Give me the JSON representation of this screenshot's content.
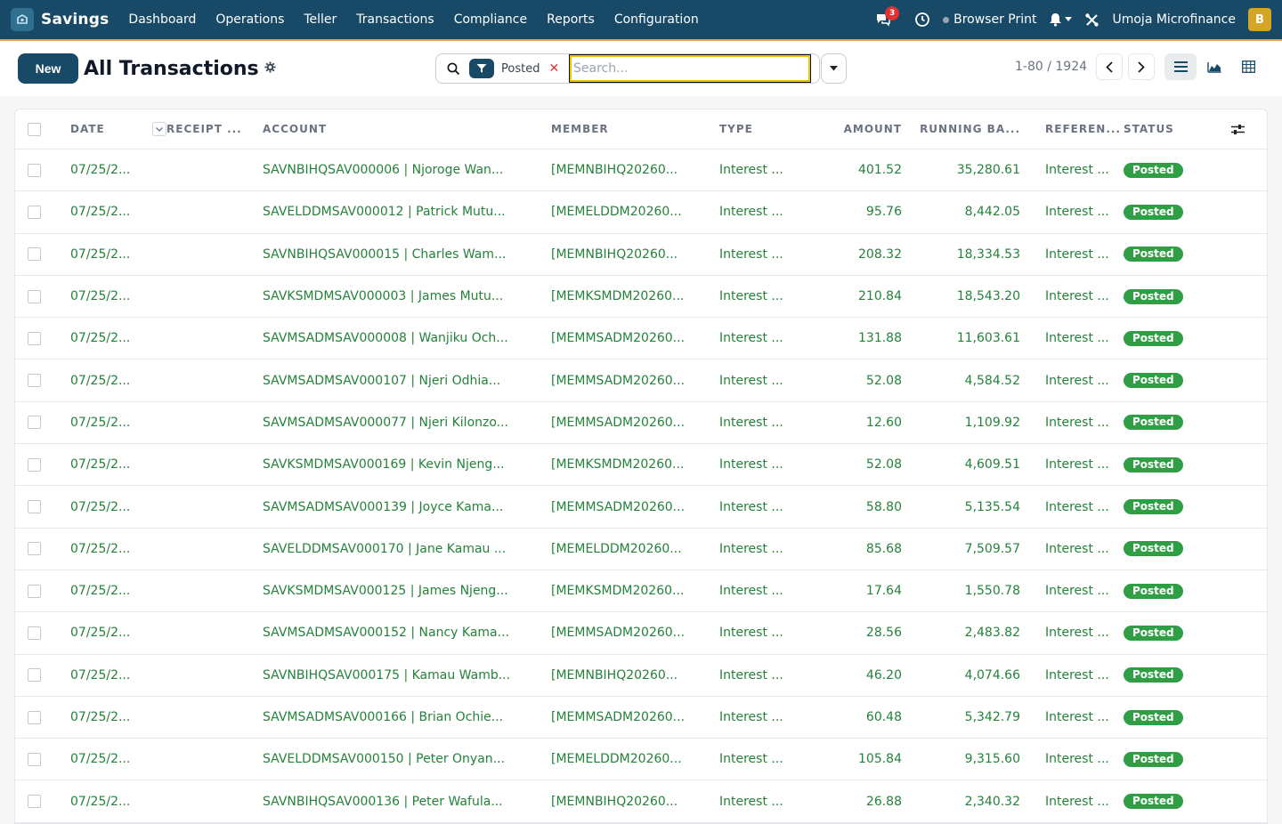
{
  "navbar": {
    "app_name": "Savings",
    "menu": [
      "Dashboard",
      "Operations",
      "Teller",
      "Transactions",
      "Compliance",
      "Reports",
      "Configuration"
    ],
    "notification_count": "3",
    "browser_print": "Browser Print",
    "company": "Umoja Microfinance",
    "avatar_letter": "B"
  },
  "controls": {
    "new_label": "New",
    "title": "All Transactions",
    "filter_label": "Posted",
    "filter_remove": "✕",
    "search_placeholder": "Search...",
    "pager_text": "1-80 / 1924"
  },
  "table": {
    "headers": {
      "date": "DATE",
      "receipt": "RECEIPT ...",
      "account": "ACCOUNT",
      "member": "MEMBER",
      "type": "TYPE",
      "amount": "AMOUNT",
      "running": "RUNNING BA...",
      "reference": "REFEREN...",
      "status": "STATUS"
    },
    "rows": [
      {
        "date": "07/25/2...",
        "account": "SAVNBIHQSAV000006 | Njoroge Wan...",
        "member": "[MEMNBIHQ20260...",
        "type": "Interest ...",
        "amount": "401.52",
        "running": "35,280.61",
        "reference": "Interest ...",
        "status": "Posted"
      },
      {
        "date": "07/25/2...",
        "account": "SAVELDDMSAV000012 | Patrick Mutu...",
        "member": "[MEMELDDM20260...",
        "type": "Interest ...",
        "amount": "95.76",
        "running": "8,442.05",
        "reference": "Interest ...",
        "status": "Posted"
      },
      {
        "date": "07/25/2...",
        "account": "SAVNBIHQSAV000015 | Charles Wam...",
        "member": "[MEMNBIHQ20260...",
        "type": "Interest ...",
        "amount": "208.32",
        "running": "18,334.53",
        "reference": "Interest ...",
        "status": "Posted"
      },
      {
        "date": "07/25/2...",
        "account": "SAVKSMDMSAV000003 | James Mutu...",
        "member": "[MEMKSMDM20260...",
        "type": "Interest ...",
        "amount": "210.84",
        "running": "18,543.20",
        "reference": "Interest ...",
        "status": "Posted"
      },
      {
        "date": "07/25/2...",
        "account": "SAVMSADMSAV000008 | Wanjiku Och...",
        "member": "[MEMMSADM20260...",
        "type": "Interest ...",
        "amount": "131.88",
        "running": "11,603.61",
        "reference": "Interest ...",
        "status": "Posted"
      },
      {
        "date": "07/25/2...",
        "account": "SAVMSADMSAV000107 | Njeri Odhia...",
        "member": "[MEMMSADM20260...",
        "type": "Interest ...",
        "amount": "52.08",
        "running": "4,584.52",
        "reference": "Interest ...",
        "status": "Posted"
      },
      {
        "date": "07/25/2...",
        "account": "SAVMSADMSAV000077 | Njeri Kilonzo...",
        "member": "[MEMMSADM20260...",
        "type": "Interest ...",
        "amount": "12.60",
        "running": "1,109.92",
        "reference": "Interest ...",
        "status": "Posted"
      },
      {
        "date": "07/25/2...",
        "account": "SAVKSMDMSAV000169 | Kevin Njeng...",
        "member": "[MEMKSMDM20260...",
        "type": "Interest ...",
        "amount": "52.08",
        "running": "4,609.51",
        "reference": "Interest ...",
        "status": "Posted"
      },
      {
        "date": "07/25/2...",
        "account": "SAVMSADMSAV000139 | Joyce Kama...",
        "member": "[MEMMSADM20260...",
        "type": "Interest ...",
        "amount": "58.80",
        "running": "5,135.54",
        "reference": "Interest ...",
        "status": "Posted"
      },
      {
        "date": "07/25/2...",
        "account": "SAVELDDMSAV000170 | Jane Kamau ...",
        "member": "[MEMELDDM20260...",
        "type": "Interest ...",
        "amount": "85.68",
        "running": "7,509.57",
        "reference": "Interest ...",
        "status": "Posted"
      },
      {
        "date": "07/25/2...",
        "account": "SAVKSMDMSAV000125 | James Njeng...",
        "member": "[MEMKSMDM20260...",
        "type": "Interest ...",
        "amount": "17.64",
        "running": "1,550.78",
        "reference": "Interest ...",
        "status": "Posted"
      },
      {
        "date": "07/25/2...",
        "account": "SAVMSADMSAV000152 | Nancy Kama...",
        "member": "[MEMMSADM20260...",
        "type": "Interest ...",
        "amount": "28.56",
        "running": "2,483.82",
        "reference": "Interest ...",
        "status": "Posted"
      },
      {
        "date": "07/25/2...",
        "account": "SAVNBIHQSAV000175 | Kamau Wamb...",
        "member": "[MEMNBIHQ20260...",
        "type": "Interest ...",
        "amount": "46.20",
        "running": "4,074.66",
        "reference": "Interest ...",
        "status": "Posted"
      },
      {
        "date": "07/25/2...",
        "account": "SAVMSADMSAV000166 | Brian Ochie...",
        "member": "[MEMMSADM20260...",
        "type": "Interest ...",
        "amount": "60.48",
        "running": "5,342.79",
        "reference": "Interest ...",
        "status": "Posted"
      },
      {
        "date": "07/25/2...",
        "account": "SAVELDDMSAV000150 | Peter Onyan...",
        "member": "[MEMELDDM20260...",
        "type": "Interest ...",
        "amount": "105.84",
        "running": "9,315.60",
        "reference": "Interest ...",
        "status": "Posted"
      },
      {
        "date": "07/25/2...",
        "account": "SAVNBIHQSAV000136 | Peter Wafula...",
        "member": "[MEMNBIHQ20260...",
        "type": "Interest ...",
        "amount": "26.88",
        "running": "2,340.32",
        "reference": "Interest ...",
        "status": "Posted"
      }
    ]
  }
}
